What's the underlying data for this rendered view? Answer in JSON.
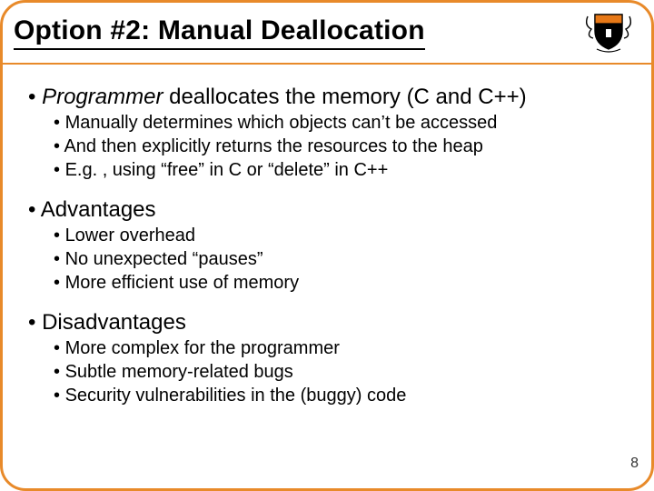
{
  "title": "Option #2: Manual Deallocation",
  "logo": {
    "name": "princeton-shield"
  },
  "sections": [
    {
      "heading_em": "Programmer",
      "heading_rest": " deallocates the memory (C and C++)",
      "items": [
        "Manually determines which objects can’t be accessed",
        "And then explicitly returns the resources to the heap",
        "E.g. , using “free” in C or “delete” in C++"
      ]
    },
    {
      "heading_em": "",
      "heading_rest": "Advantages",
      "items": [
        "Lower overhead",
        "No unexpected “pauses”",
        "More efficient use of memory"
      ]
    },
    {
      "heading_em": "",
      "heading_rest": "Disadvantages",
      "items": [
        "More complex for the programmer",
        "Subtle memory-related bugs",
        "Security vulnerabilities in the (buggy) code"
      ]
    }
  ],
  "page_number": "8"
}
